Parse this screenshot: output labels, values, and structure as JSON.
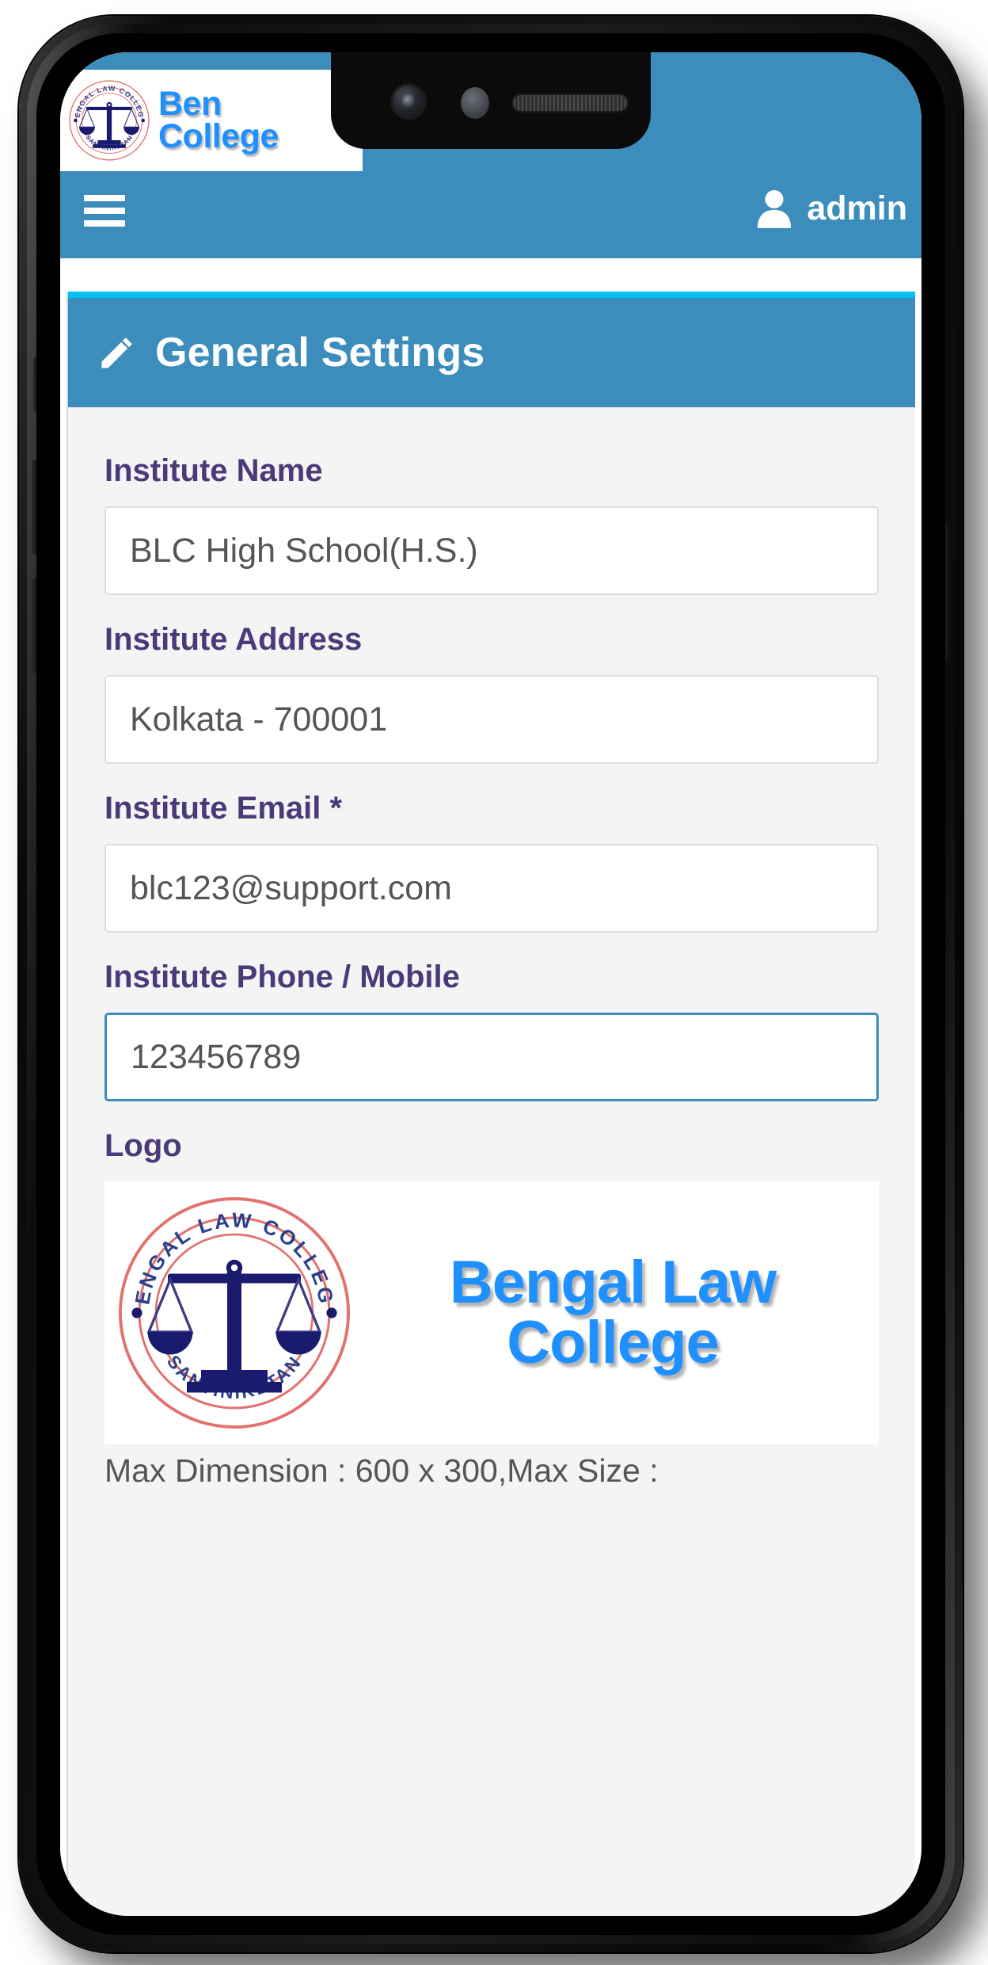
{
  "brand": {
    "logo_alt": "bengal-law-college-seal",
    "wordmark_line1": "Ben",
    "wordmark_line2": "College",
    "seal_top_text": "BENGAL LAW COLLEGE",
    "seal_bottom_text": "SANTINIKETAN"
  },
  "navbar": {
    "menu_icon": "hamburger-icon",
    "user_icon": "user-icon",
    "user_name": "admin"
  },
  "panel": {
    "icon": "pencil-icon",
    "title": "General Settings"
  },
  "form": {
    "fields": [
      {
        "label": "Institute Name",
        "value": "BLC High School(H.S.)",
        "placeholder": "Institute Name",
        "focused": false,
        "name": "institute-name"
      },
      {
        "label": "Institute Address",
        "value": "Kolkata - 700001",
        "placeholder": "Institute Address",
        "focused": false,
        "name": "institute-address"
      },
      {
        "label": "Institute Email *",
        "value": "blc123@support.com",
        "placeholder": "Institute Email",
        "focused": false,
        "name": "institute-email"
      },
      {
        "label": "Institute Phone / Mobile",
        "value": "123456789",
        "placeholder": "Institute Phone / Mobile",
        "focused": true,
        "name": "institute-phone"
      }
    ],
    "logo": {
      "label": "Logo",
      "wordmark_line1": "Bengal Law",
      "wordmark_line2": "College",
      "hint": "Max Dimension : 600 x 300,Max Size :"
    }
  },
  "colors": {
    "brand_blue": "#3c8dbc",
    "accent_cyan": "#00c0ef",
    "label_purple": "#4b3a79",
    "logo_blue": "#1e90ff",
    "seal_red": "#d9534f",
    "seal_navy": "#1a1a6e",
    "page_bg": "#f4f4f4"
  }
}
